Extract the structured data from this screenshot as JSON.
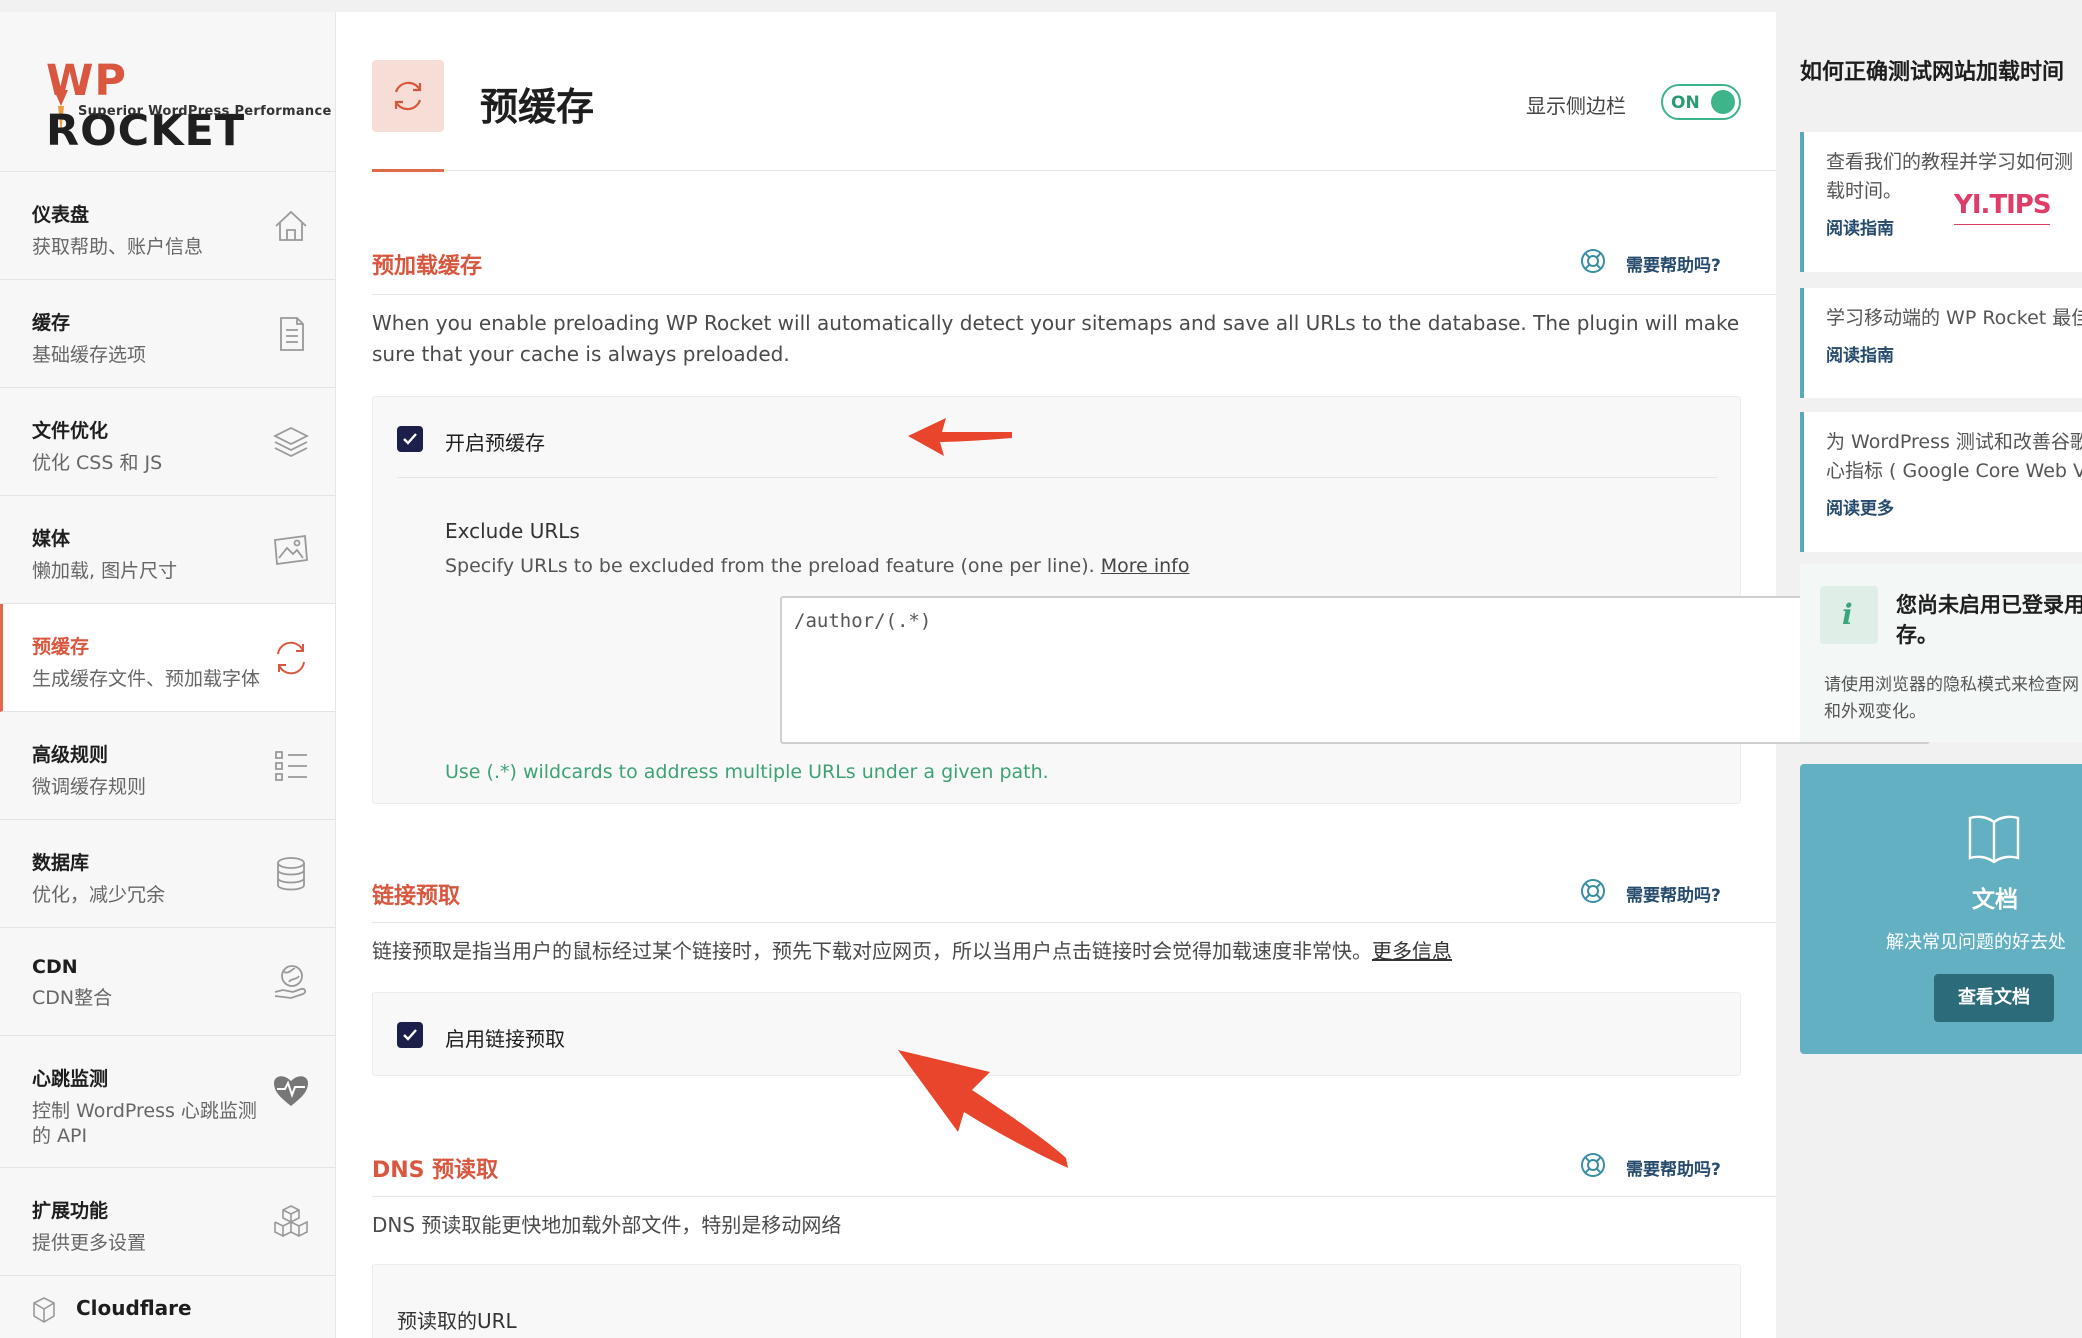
{
  "logo": {
    "brand_wp": "WP",
    "brand_rest": " ROCKET",
    "tagline": "Superior WordPress Performance"
  },
  "sidebar": {
    "items": [
      {
        "title": "仪表盘",
        "sub": "获取帮助、账户信息",
        "icon": "home-icon"
      },
      {
        "title": "缓存",
        "sub": "基础缓存选项",
        "icon": "file-icon"
      },
      {
        "title": "文件优化",
        "sub": "优化 CSS 和 JS",
        "icon": "layers-icon"
      },
      {
        "title": "媒体",
        "sub": "懒加载, 图片尺寸",
        "icon": "image-icon"
      },
      {
        "title": "预缓存",
        "sub": "生成缓存文件、预加载字体",
        "icon": "refresh-icon",
        "active": true
      },
      {
        "title": "高级规则",
        "sub": "微调缓存规则",
        "icon": "list-icon"
      },
      {
        "title": "数据库",
        "sub": "优化，减少冗余",
        "icon": "database-icon"
      },
      {
        "title": "CDN",
        "sub": "CDN整合",
        "icon": "globe-hand-icon"
      },
      {
        "title": "心跳监测",
        "sub": "控制 WordPress 心跳监测的 API",
        "icon": "heartbeat-icon"
      },
      {
        "title": "扩展功能",
        "sub": "提供更多设置",
        "icon": "cubes-icon"
      }
    ],
    "cloudflare": "Cloudflare"
  },
  "header": {
    "title": "预缓存",
    "toggle_label": "显示侧边栏",
    "toggle_state": "ON"
  },
  "sections": {
    "preload": {
      "title": "预加载缓存",
      "help": "需要帮助吗?",
      "desc": "When you enable preloading WP Rocket will automatically detect your sitemaps and save all URLs to the database. The plugin will make sure that your cache is always preloaded.",
      "option_label": "开启预缓存",
      "exclude_title": "Exclude URLs",
      "exclude_desc": "Specify URLs to be excluded from the preload feature (one per line). ",
      "exclude_more": "More info",
      "exclude_value": "/author/(.*)",
      "hint": "Use (.*) wildcards to address multiple URLs under a given path."
    },
    "link_prefetch": {
      "title": "链接预取",
      "help": "需要帮助吗?",
      "desc": "链接预取是指当用户的鼠标经过某个链接时，预先下载对应网页，所以当用户点击链接时会觉得加载速度非常快。",
      "more": "更多信息",
      "option_label": "启用链接预取"
    },
    "dns": {
      "title": "DNS 预读取",
      "help": "需要帮助吗?",
      "desc": "DNS 预读取能更快地加载外部文件，特别是移动网络",
      "url_title": "预读取的URL"
    }
  },
  "right": {
    "title": "如何正确测试网站加载时间",
    "cards": [
      {
        "line1": "查看我们的教程并学习如何测",
        "line2": "载时间。",
        "link": "阅读指南"
      },
      {
        "line1": "学习移动端的 WP Rocket 最佳",
        "line2": "",
        "link": "阅读指南"
      },
      {
        "line1": "为 WordPress 测试和改善谷歌",
        "line2": "心指标 ( Google Core Web V",
        "link": "阅读更多"
      }
    ],
    "watermark": "YI.TIPS",
    "info": {
      "title_line1": "您尚未启用已登录用",
      "title_line2": "存。",
      "text_line1": "请使用浏览器的隐私模式来检查网",
      "text_line2": "和外观变化。"
    },
    "docs": {
      "title": "文档",
      "sub": "解决常见问题的好去处",
      "button": "查看文档"
    }
  },
  "colors": {
    "accent": "#d8573e",
    "toggle_on": "#3db489",
    "checkbox": "#1b1f4a",
    "docs_bg": "#63b0c2",
    "help_link": "#264b6d",
    "arrow": "#e8452c"
  }
}
